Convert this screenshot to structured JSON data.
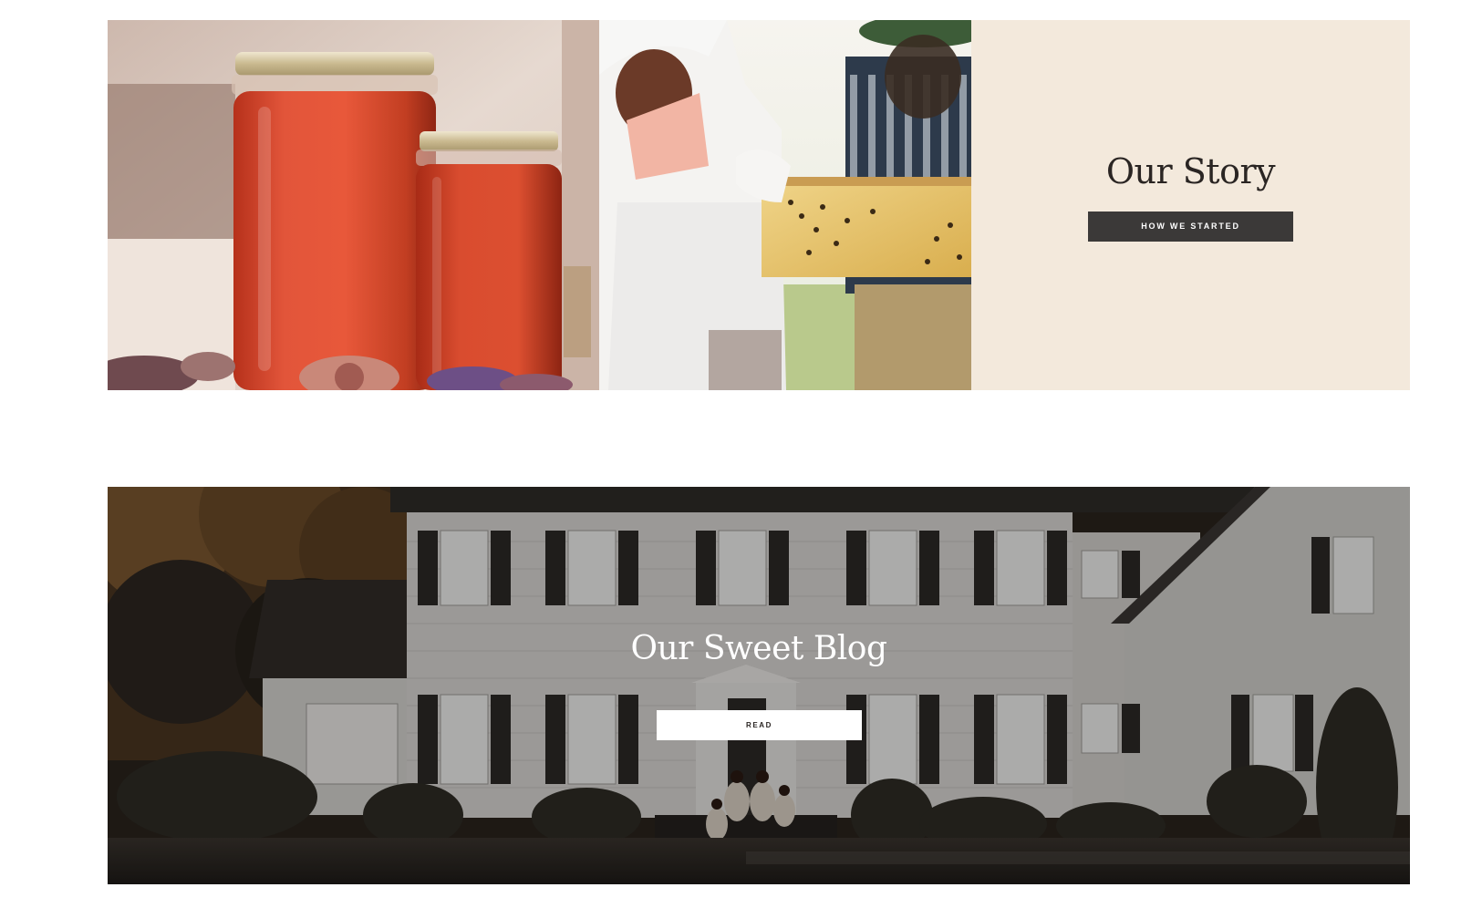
{
  "story": {
    "title": "Our Story",
    "button_label": "HOW WE STARTED",
    "panel_color": "#f3e9dc",
    "button_color": "#3b3938"
  },
  "blog": {
    "title": "Our Sweet Blog",
    "button_label": "READ",
    "button_color": "#ffffff"
  },
  "images": {
    "honey": "honey-jars-photo",
    "bees": "beekeepers-photo",
    "house": "farmhouse-family-photo"
  }
}
